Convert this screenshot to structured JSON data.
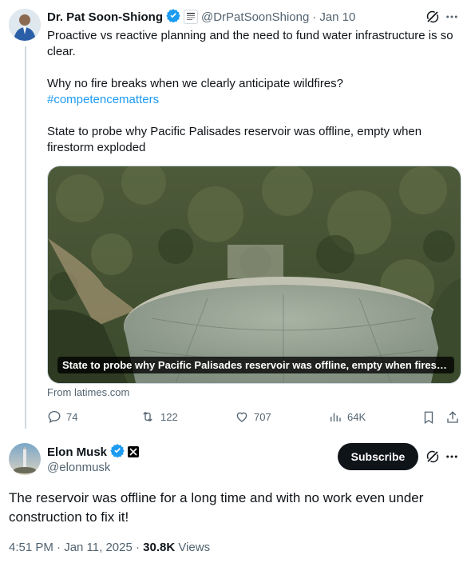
{
  "parent_tweet": {
    "author_name": "Dr. Pat Soon-Shiong",
    "handle": "@DrPatSoonShiong",
    "date": "Jan 10",
    "paragraphs": {
      "p1": "Proactive vs reactive planning and the need to fund water infrastructure is so clear.",
      "p2": "Why no fire breaks when we clearly anticipate wildfires?",
      "hashtag": "#competencematters",
      "p3": "State to probe why Pacific Palisades reservoir was offline, empty when firestorm exploded"
    },
    "card": {
      "image_icon": "reservoir-aerial-photo",
      "caption": "State to probe why Pacific Palisades reservoir was offline, empty when firestor...",
      "source": "From latimes.com"
    },
    "stats": {
      "replies": "74",
      "reposts": "122",
      "likes": "707",
      "views": "64K"
    }
  },
  "main_tweet": {
    "author_name": "Elon Musk",
    "handle": "@elonmusk",
    "subscribe_label": "Subscribe",
    "text": "The reservoir was offline for a long time and with no work even under construction to fix it!",
    "meta": {
      "time_date": "4:51 PM · Jan 11, 2025 · ",
      "views_count": "30.8K",
      "views_label": " Views"
    }
  },
  "colors": {
    "verified_blue": "#1d9bf0",
    "link": "#1d9bf0",
    "muted": "#536471"
  }
}
